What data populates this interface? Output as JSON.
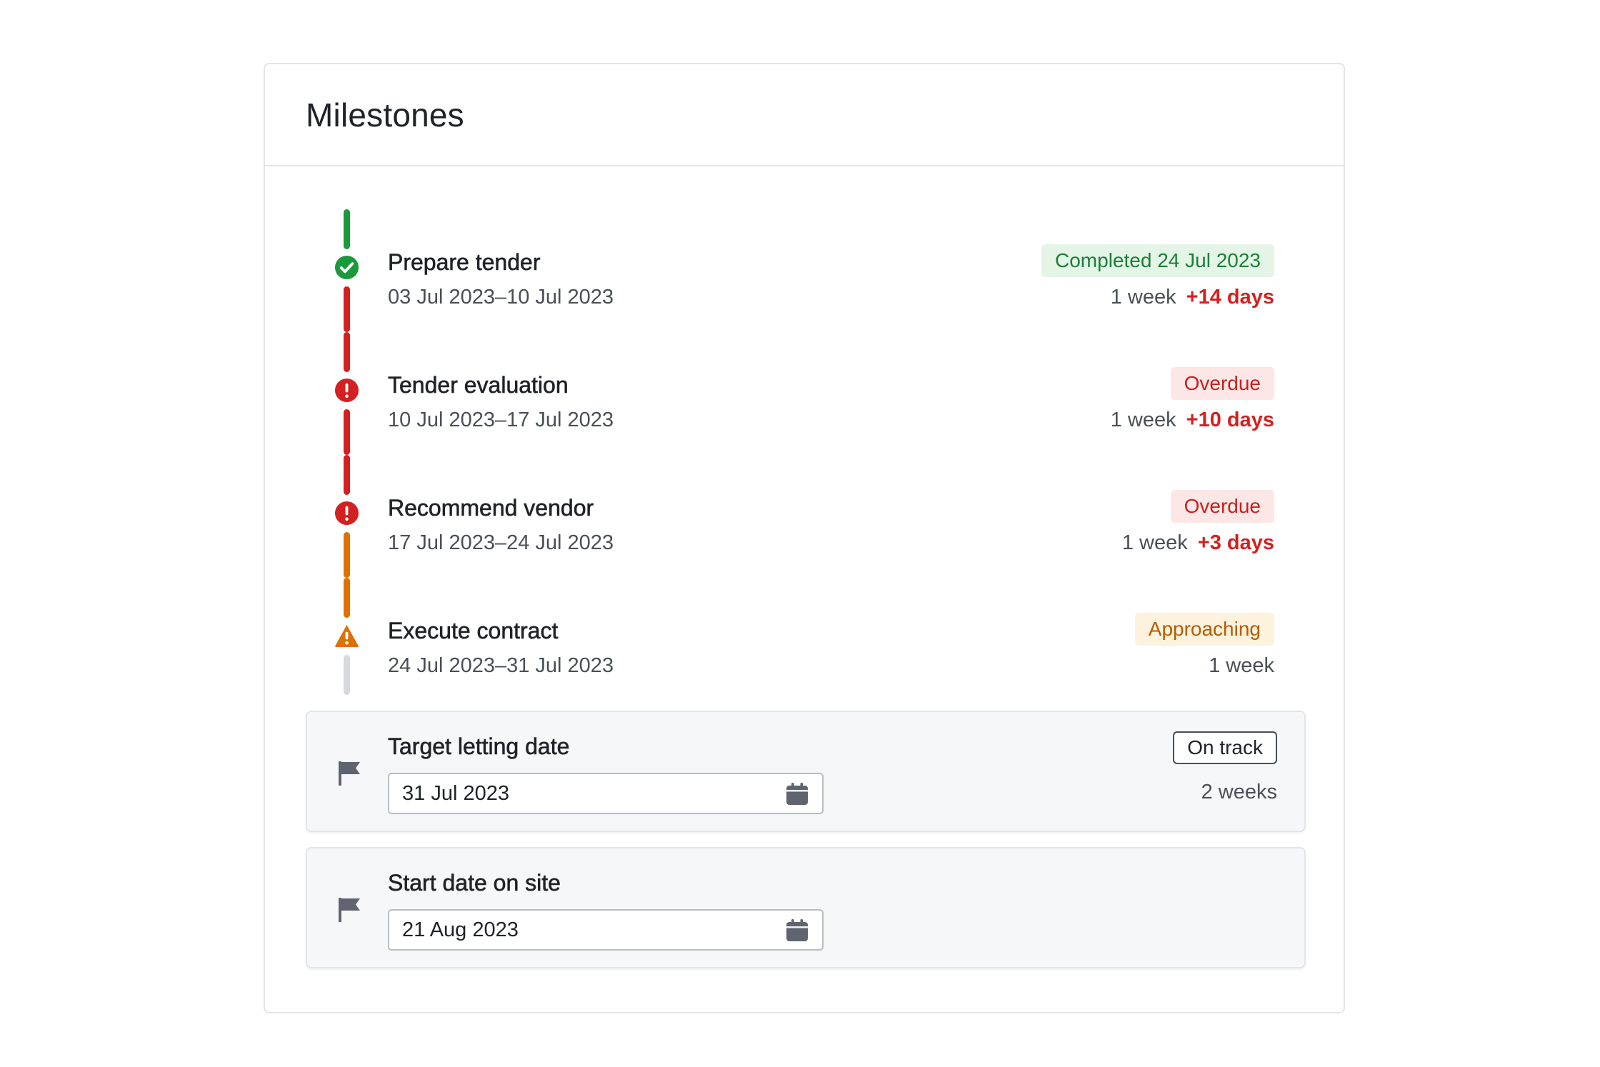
{
  "card": {
    "title": "Milestones"
  },
  "colors": {
    "completed": "#1a9a3a",
    "overdue": "#d42020",
    "approaching": "#e07000",
    "pending": "#d6d9dd"
  },
  "milestones": [
    {
      "name": "Prepare tender",
      "dates": "03 Jul 2023–10 Jul 2023",
      "status_label": "Completed 24 Jul 2023",
      "status": "completed",
      "icon": "check-circle-icon",
      "duration": "1 week",
      "delay": "+14 days"
    },
    {
      "name": "Tender evaluation",
      "dates": "10 Jul 2023–17 Jul 2023",
      "status_label": "Overdue",
      "status": "overdue",
      "icon": "exclamation-circle-icon",
      "duration": "1 week",
      "delay": "+10 days"
    },
    {
      "name": "Recommend vendor",
      "dates": "17 Jul 2023–24 Jul 2023",
      "status_label": "Overdue",
      "status": "overdue",
      "icon": "exclamation-circle-icon",
      "duration": "1 week",
      "delay": "+3 days"
    },
    {
      "name": "Execute contract",
      "dates": "24 Jul 2023–31 Jul 2023",
      "status_label": "Approaching",
      "status": "approaching",
      "icon": "warning-triangle-icon",
      "duration": "1 week",
      "delay": ""
    }
  ],
  "target_letting": {
    "label": "Target letting date",
    "date": "31 Jul 2023",
    "status_label": "On track",
    "duration": "2 weeks",
    "icon": "flag-icon"
  },
  "start_on_site": {
    "label": "Start date on site",
    "date": "21 Aug 2023",
    "icon": "flag-icon"
  }
}
